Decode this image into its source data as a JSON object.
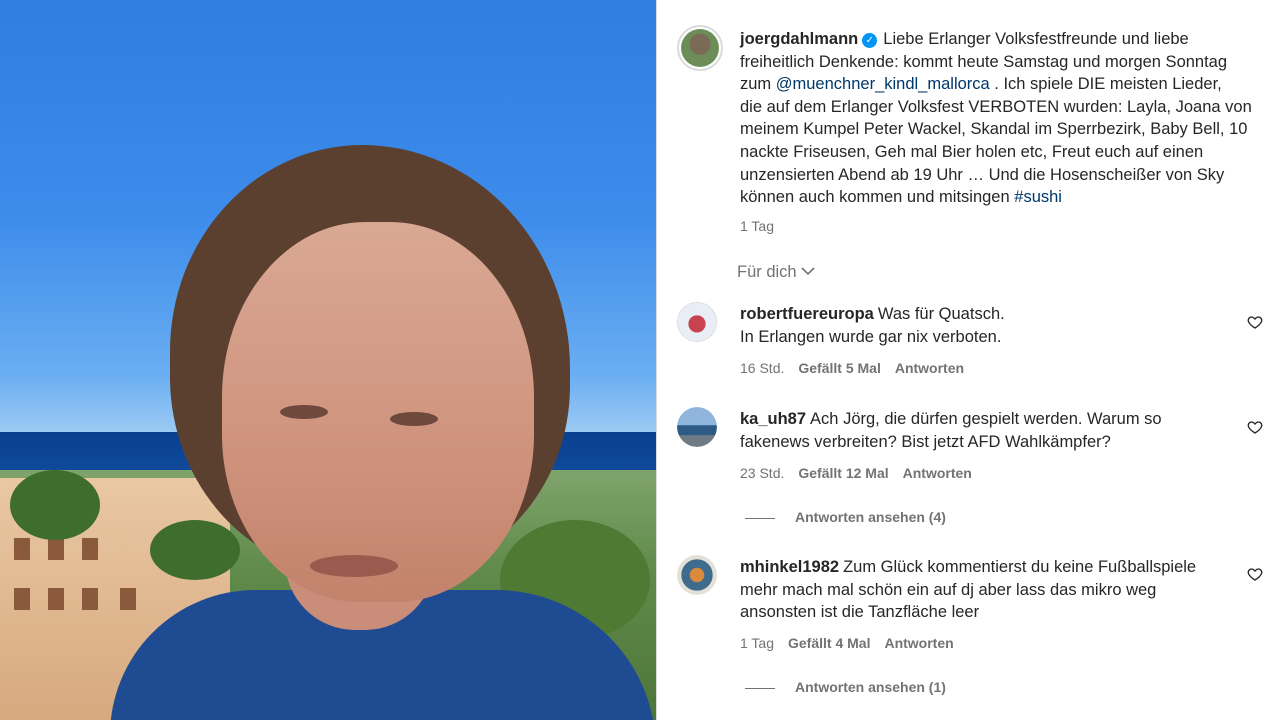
{
  "post": {
    "username": "joergdahlmann",
    "verified_icon": "verified-badge-icon",
    "caption_lines": [
      "Liebe Erlanger Volksfestfreunde und liebe",
      "freiheitlich Denkende: kommt heute Samstag und morgen Sonntag",
      "zum",
      "@muenchner_kindl_mallorca",
      ". Ich spiele DIE meisten Lieder,",
      "die auf dem Erlanger Volksfest VERBOTEN wurden: Layla, Joana von",
      "meinem Kumpel Peter Wackel, Skandal im Sperrbezirk, Baby Bell, 10",
      "nackte Friseusen, Geh mal Bier holen etc, Freut euch auf einen",
      "unzensierten Abend ab 19 Uhr … Und die Hosenscheißer von Sky",
      "können auch kommen und mitsingen",
      "#sushi"
    ],
    "time": "1 Tag"
  },
  "fuer_dich": "Für dich",
  "comments": [
    {
      "username": "robertfuereuropa",
      "lines": [
        "Was für Quatsch.",
        "In Erlangen wurde gar nix verboten."
      ],
      "time": "16 Std.",
      "likes": "Gefällt 5 Mal",
      "reply": "Antworten"
    },
    {
      "username": "ka_uh87",
      "lines": [
        "Ach Jörg, die dürfen gespielt werden. Warum so",
        "fakenews verbreiten? Bist jetzt AFD Wahlkämpfer?"
      ],
      "time": "23 Std.",
      "likes": "Gefällt 12 Mal",
      "reply": "Antworten",
      "view_replies": "Antworten ansehen (4)"
    },
    {
      "username": "mhinkel1982",
      "lines": [
        "Zum Glück kommentierst du keine Fußballspiele",
        "mehr mach mal schön ein auf dj aber lass das mikro weg",
        "ansonsten ist die Tanzfläche leer"
      ],
      "time": "1 Tag",
      "likes": "Gefällt 4 Mal",
      "reply": "Antworten",
      "view_replies": "Antworten ansehen (1)"
    }
  ],
  "colors": {
    "link": "#00376b",
    "verified": "#0095f6",
    "meta": "#737373"
  }
}
